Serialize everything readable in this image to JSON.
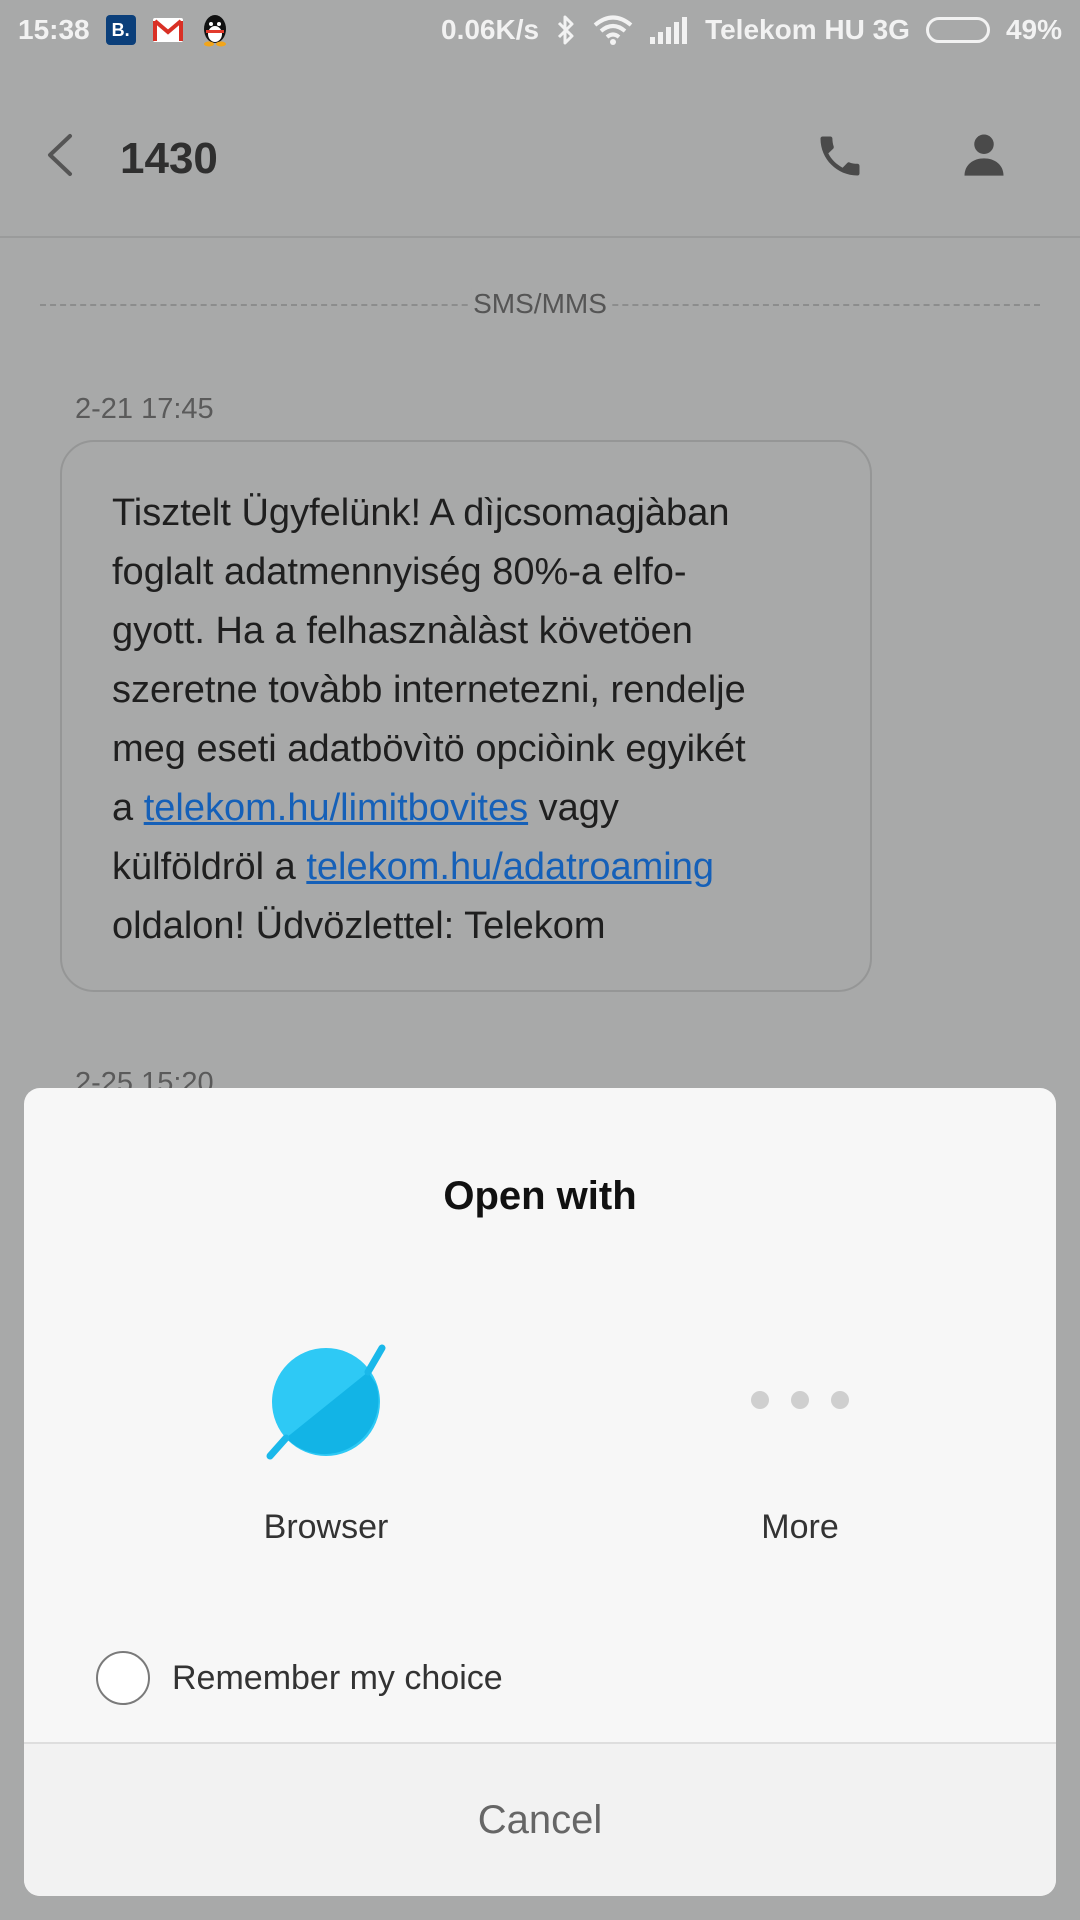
{
  "status_bar": {
    "time": "15:38",
    "notification_b_letter": "B.",
    "speed": "0.06K/s",
    "carrier": "Telekom HU 3G",
    "battery": "49%",
    "battery_level": 0.49
  },
  "header": {
    "title": "1430"
  },
  "conversation": {
    "channel_label": "SMS/MMS",
    "messages": [
      {
        "timestamp": "2-21 17:45",
        "line1": "Tisztelt Ügyfelünk! A dìjcsomagjàban",
        "line2": "foglalt adatmennyiség 80%-a elfo-",
        "line3": "gyott. Ha a felhasznàlàst követöen",
        "line4": "szeretne tovàbb internetezni, rendelje",
        "line5": "meg eseti adatbövìtö opciòink egyikét",
        "line6_prefix": "a",
        "link1": "telekom.hu/limitbovites",
        "line6_suffix": "vagy",
        "line7_prefix": "külföldröl a",
        "link2": "telekom.hu/adatroaming",
        "line8": "oldalon! Üdvözlettel: Telekom"
      },
      {
        "timestamp": "2-25 15:20"
      }
    ]
  },
  "dialog": {
    "title": "Open with",
    "apps": [
      {
        "label": "Browser",
        "icon": "browser-planet-icon"
      },
      {
        "label": "More",
        "icon": "more-dots-icon"
      }
    ],
    "remember_label": "Remember my choice",
    "cancel_label": "Cancel"
  },
  "colors": {
    "link": "#1560b8",
    "browser_icon": "#2ec9f5",
    "scrim": "#a8a9a9",
    "dialog_bg": "#f7f7f7"
  }
}
